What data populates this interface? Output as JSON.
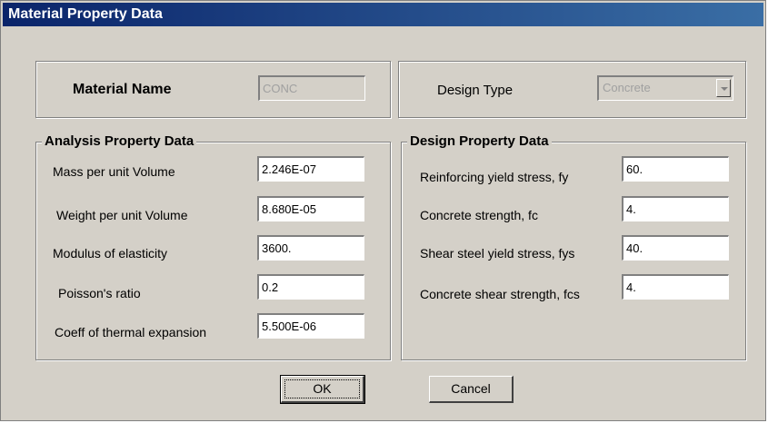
{
  "window": {
    "title": "Material Property Data"
  },
  "material": {
    "name_label": "Material Name",
    "name_value": "CONC"
  },
  "design_type": {
    "label": "Design Type",
    "value": "Concrete"
  },
  "analysis": {
    "title": "Analysis Property Data",
    "fields": [
      {
        "label": "Mass per unit Volume",
        "value": "2.246E-07"
      },
      {
        "label": "Weight per unit Volume",
        "value": "8.680E-05"
      },
      {
        "label": "Modulus of elasticity",
        "value": "3600."
      },
      {
        "label": "Poisson's ratio",
        "value": "0.2"
      },
      {
        "label": "Coeff of thermal expansion",
        "value": "5.500E-06"
      }
    ]
  },
  "design": {
    "title": "Design Property Data",
    "fields": [
      {
        "label": "Reinforcing yield stress, fy",
        "value": "60."
      },
      {
        "label": "Concrete strength, fc",
        "value": "4."
      },
      {
        "label": "Shear steel yield stress, fys",
        "value": "40."
      },
      {
        "label": "Concrete shear strength, fcs",
        "value": "4."
      }
    ]
  },
  "buttons": {
    "ok": "OK",
    "cancel": "Cancel"
  }
}
